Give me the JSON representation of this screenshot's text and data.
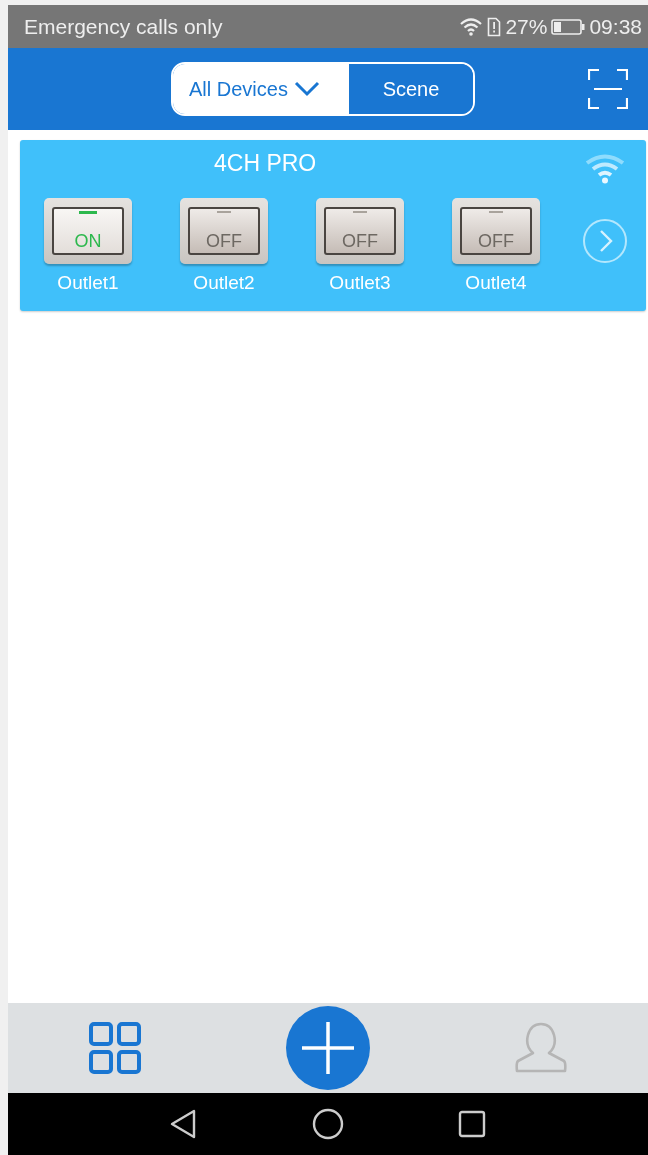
{
  "status_bar": {
    "carrier": "Emergency calls only",
    "battery": "27%",
    "time": "09:38"
  },
  "header": {
    "tabs": [
      {
        "label": "All Devices",
        "selected": true,
        "dropdown": true
      },
      {
        "label": "Scene",
        "selected": false,
        "dropdown": false
      }
    ]
  },
  "devices": [
    {
      "name": "4CH PRO",
      "online": true,
      "outlets": [
        {
          "label": "Outlet1",
          "switch_text": "ON",
          "on": true
        },
        {
          "label": "Outlet2",
          "switch_text": "OFF",
          "on": false
        },
        {
          "label": "Outlet3",
          "switch_text": "OFF",
          "on": false
        },
        {
          "label": "Outlet4",
          "switch_text": "OFF",
          "on": false
        }
      ]
    }
  ],
  "bottom_nav": [
    {
      "kind": "devices",
      "selected": true
    },
    {
      "kind": "add",
      "selected": false
    },
    {
      "kind": "profile",
      "selected": false
    }
  ]
}
